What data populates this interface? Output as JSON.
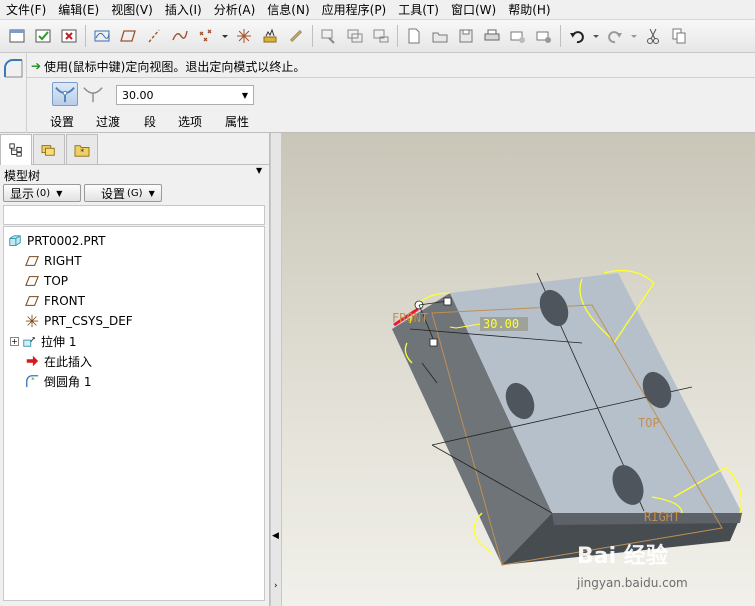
{
  "menu": [
    "文件(F)",
    "编辑(E)",
    "视图(V)",
    "插入(I)",
    "分析(A)",
    "信息(N)",
    "应用程序(P)",
    "工具(T)",
    "窗口(W)",
    "帮助(H)"
  ],
  "dashboard": {
    "message": "使用(鼠标中键)定向视图。退出定向模式以终止。",
    "radius_value": "30.00",
    "tabs": [
      "设置",
      "过渡",
      "段",
      "选项",
      "属性"
    ]
  },
  "model_tree": {
    "title": "模型树",
    "show_button": "显示",
    "show_key": "(0)",
    "settings_button": "设置",
    "settings_key": "(G)",
    "items": [
      {
        "label": "PRT0002.PRT"
      },
      {
        "label": "RIGHT"
      },
      {
        "label": "TOP"
      },
      {
        "label": "FRONT"
      },
      {
        "label": "PRT_CSYS_DEF"
      },
      {
        "label": "拉伸 1"
      },
      {
        "label": "在此插入"
      },
      {
        "label": "倒圆角 1"
      }
    ]
  },
  "viewport": {
    "dimension_label": "30.00",
    "datum_labels": {
      "front": "FRONT",
      "top": "TOP",
      "right": "RIGHT"
    }
  },
  "watermark": {
    "logo": "Bai 经验",
    "url": "jingyan.baidu.com"
  },
  "colors": {
    "part_top": "#b8c2cd",
    "part_front": "#6f7479",
    "part_side": "#9aa2aa",
    "hole": "#4e555c",
    "datum": "#c08f53",
    "edge_highlight": "#ffff30",
    "selection": "#e81c3a"
  }
}
